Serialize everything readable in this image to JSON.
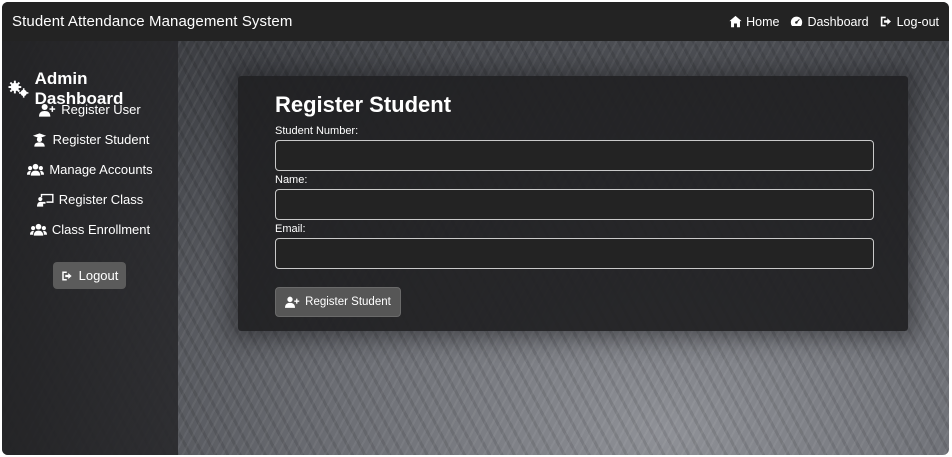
{
  "navbar": {
    "brand": "Student Attendance Management System",
    "links": [
      {
        "label": "Home",
        "icon": "home-icon"
      },
      {
        "label": "Dashboard",
        "icon": "gauge-icon"
      },
      {
        "label": "Log-out",
        "icon": "logout-icon"
      }
    ]
  },
  "sidebar": {
    "title": "Admin Dashboard",
    "title_icon": "gears-icon",
    "items": [
      {
        "label": "Register User",
        "icon": "user-plus-icon"
      },
      {
        "label": "Register Student",
        "icon": "graduate-icon"
      },
      {
        "label": "Manage Accounts",
        "icon": "users-icon"
      },
      {
        "label": "Register Class",
        "icon": "chalkboard-icon"
      },
      {
        "label": "Class Enrollment",
        "icon": "users-icon"
      }
    ],
    "logout_label": "Logout"
  },
  "form": {
    "title": "Register Student",
    "fields": [
      {
        "label": "Student Number:",
        "value": "",
        "placeholder": ""
      },
      {
        "label": "Name:",
        "value": "",
        "placeholder": ""
      },
      {
        "label": "Email:",
        "value": "",
        "placeholder": ""
      }
    ],
    "submit_label": "Register Student"
  },
  "colors": {
    "navbar_bg": "#232323",
    "sidebar_bg": "#28282b",
    "card_bg": "#202022",
    "button_bg": "#565656",
    "text": "#ffffff"
  }
}
